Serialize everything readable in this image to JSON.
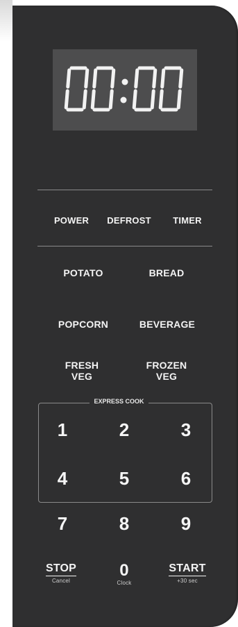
{
  "display": {
    "time": "00:00"
  },
  "function_row": [
    "POWER",
    "DEFROST",
    "TIMER"
  ],
  "presets": {
    "potato": "POTATO",
    "bread": "BREAD",
    "popcorn": "POPCORN",
    "beverage": "BEVERAGE",
    "fresh_veg": "FRESH\nVEG",
    "frozen_veg": "FROZEN\nVEG"
  },
  "express_cook_label": "EXPRESS COOK",
  "keypad": [
    "1",
    "2",
    "3",
    "4",
    "5",
    "6",
    "7",
    "8",
    "9",
    "0"
  ],
  "stop": {
    "label": "STOP",
    "sub": "Cancel"
  },
  "zero_sub": "Clock",
  "start": {
    "label": "START",
    "sub": "+30 sec"
  }
}
